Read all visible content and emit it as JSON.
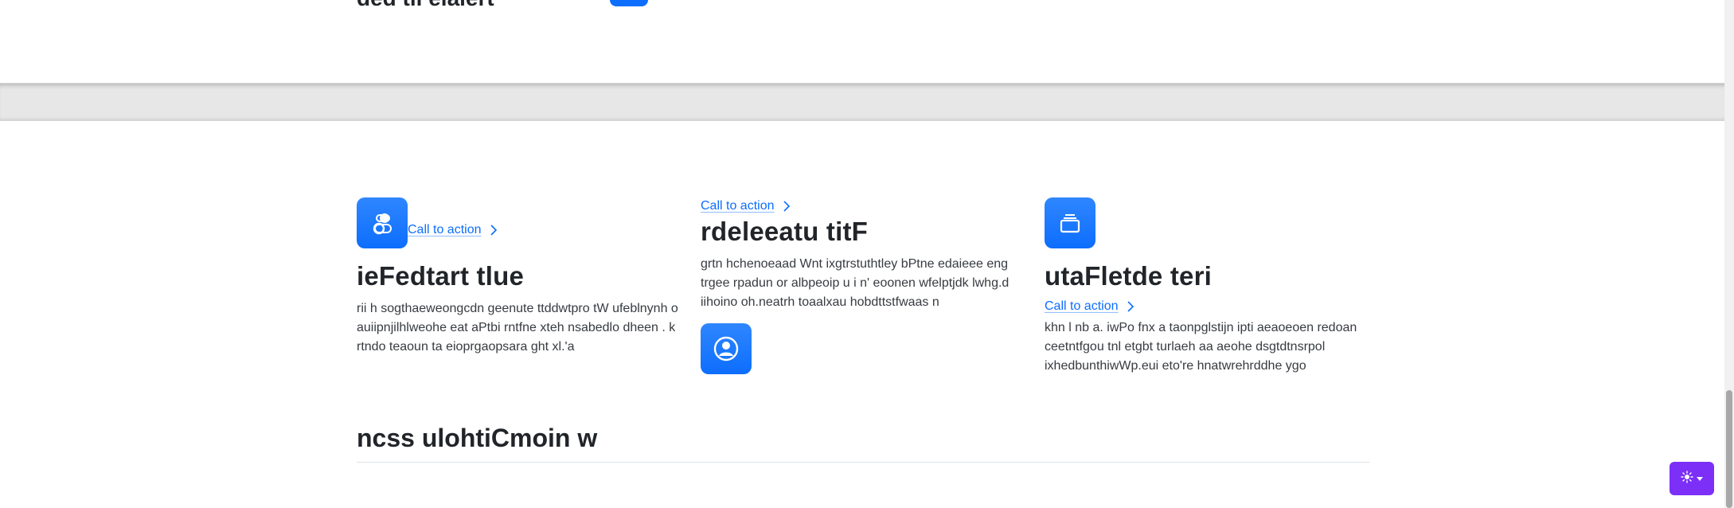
{
  "top": {
    "heading": "ded tii elalert",
    "icon": "app-icon"
  },
  "features": [
    {
      "icon": "toggles-icon",
      "cta_label": "Call to action",
      "title": "ieFedtart tlue",
      "text": "rii h sogthaeweongcdn geenute ttddwtpro tW ufeblnynh o auiipnjilhlweohe eat aPtbi rntfne xteh nsabedlo dheen . k rtndo teaoun ta eioprgaopsara ght xl.'a"
    },
    {
      "icon": "person-circle-icon",
      "cta_label": "Call to action",
      "title": "rdeleeatu titF",
      "text": "grtn hchenoeaad Wnt ixgtrstuthtley bPtne edaieee eng trgee rpadun or albpeoip u i n' eoonen wfelptjdk lwhg.d iihoino oh.neatrh toaalxau hobdttstfwaas n"
    },
    {
      "icon": "collection-icon",
      "cta_label": "Call to action",
      "title": "utaFletde teri",
      "text": "khn l nb a. iwPo fnx a taonpglstijn ipti aeaoeoen redoan ceetntfgou tnl etgbt turlaeh aa aeohe dsgtdtnsrpol ixhedbunthiwWp.eui eto're hnatwrehrddhe ygo"
    }
  ],
  "section": {
    "heading": "ncss ulohtiCmoin w"
  },
  "theme_toggle": {
    "icon": "sun-icon",
    "caret": "caret-down-icon",
    "color": "#7b2ff7"
  },
  "colors": {
    "accent": "#0d6efd",
    "divider_band": "#e7e7e7"
  }
}
